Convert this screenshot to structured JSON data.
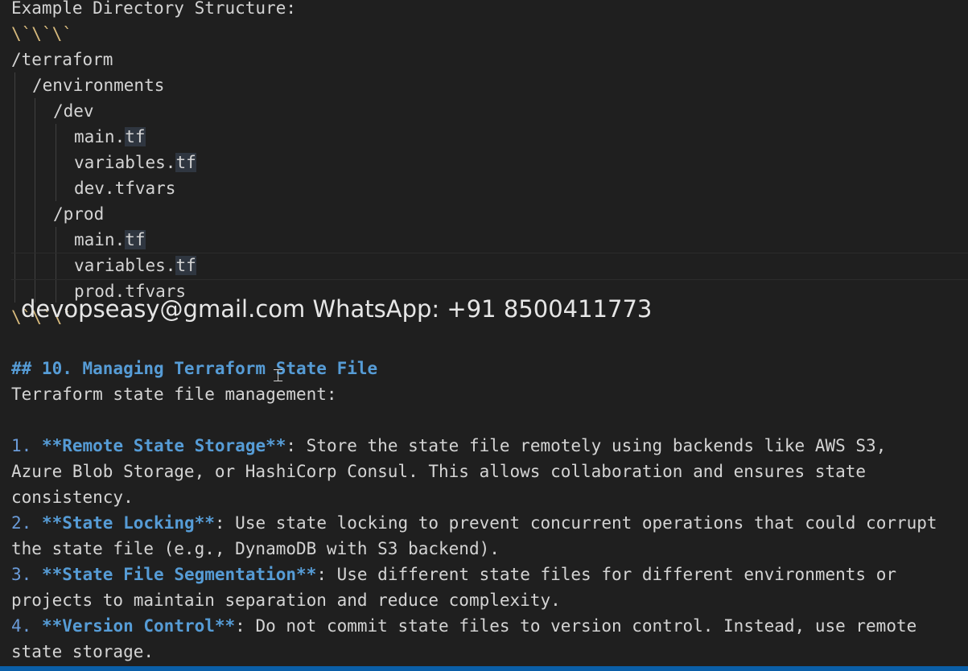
{
  "document": {
    "directory_heading": "Example Directory Structure:",
    "fence_open": "\\`\\`\\`",
    "tree": {
      "root": "/terraform",
      "environments": "/environments",
      "dev": "/dev",
      "dev_main_base": "main.",
      "dev_main_ext": "tf",
      "dev_vars_base": "variables.",
      "dev_vars_ext": "tf",
      "dev_tfvars": "dev.tfvars",
      "prod": "/prod",
      "prod_main_base": "main.",
      "prod_main_ext": "tf",
      "prod_vars_base": "variables.",
      "prod_vars_ext": "tf",
      "prod_tfvars": "prod.tfvars"
    },
    "fence_close": "\\`\\`\\`",
    "section_heading": "## 10. Managing Terraform State File",
    "intro": "Terraform state file management:",
    "items": [
      {
        "num": "1.",
        "bold": "**Remote State Storage**",
        "text1": ": Store the state file remotely using backends like AWS S3,",
        "text2": "Azure Blob Storage, or HashiCorp Consul. This allows collaboration and ensures state",
        "text3": "consistency."
      },
      {
        "num": "2.",
        "bold": "**State Locking**",
        "text1": ": Use state locking to prevent concurrent operations that could corrupt",
        "text2": "the state file (e.g., DynamoDB with S3 backend)."
      },
      {
        "num": "3.",
        "bold": "**State File Segmentation**",
        "text1": ": Use different state files for different environments or",
        "text2": "projects to maintain separation and reduce complexity."
      },
      {
        "num": "4.",
        "bold": "**Version Control**",
        "text1": ": Do not commit state files to version control. Instead, use remote",
        "text2": "state storage."
      }
    ]
  },
  "overlay": {
    "watermark": "devopseasy@gmail.com WhatsApp: +91 8500411773"
  },
  "colors": {
    "background": "#1f1f1f",
    "text": "#d4d4d4",
    "markdown_accent": "#569cd6",
    "status_bar": "#0a5fa8"
  }
}
